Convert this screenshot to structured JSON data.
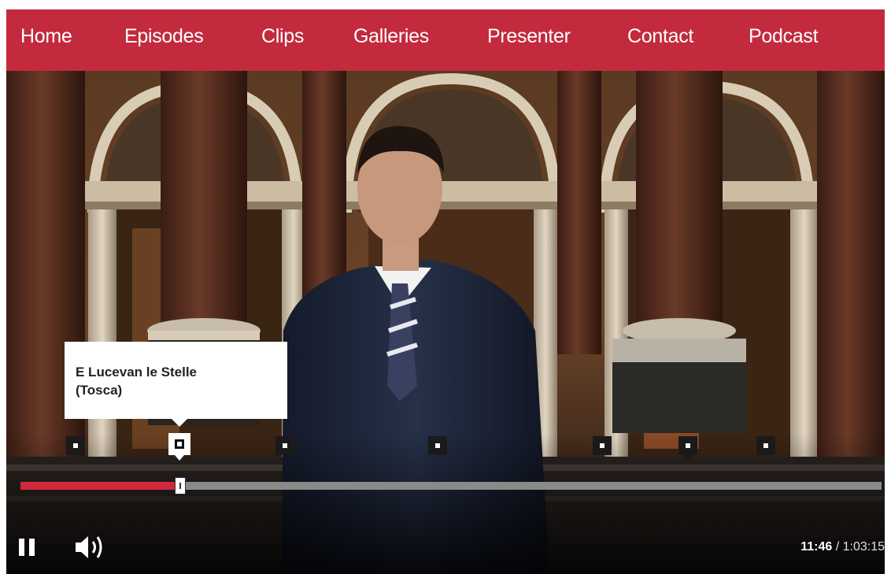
{
  "nav": {
    "items": [
      {
        "label": "Home"
      },
      {
        "label": "Episodes"
      },
      {
        "label": "Clips"
      },
      {
        "label": "Galleries"
      },
      {
        "label": "Presenter"
      },
      {
        "label": "Contact"
      },
      {
        "label": "Podcast"
      }
    ]
  },
  "tooltip": {
    "line1": "E Lucevan le Stelle",
    "line2": "(Tosca)"
  },
  "player": {
    "current_time": "11:46",
    "separator": " / ",
    "duration": "1:03:15",
    "progress_fraction": 0.186,
    "is_playing": true
  },
  "colors": {
    "brand": "#c32a3e",
    "progress_fill": "#d0283c",
    "progress_track": "#8a8a8a"
  },
  "icons": {
    "pause": "pause-icon",
    "volume": "volume-icon"
  }
}
